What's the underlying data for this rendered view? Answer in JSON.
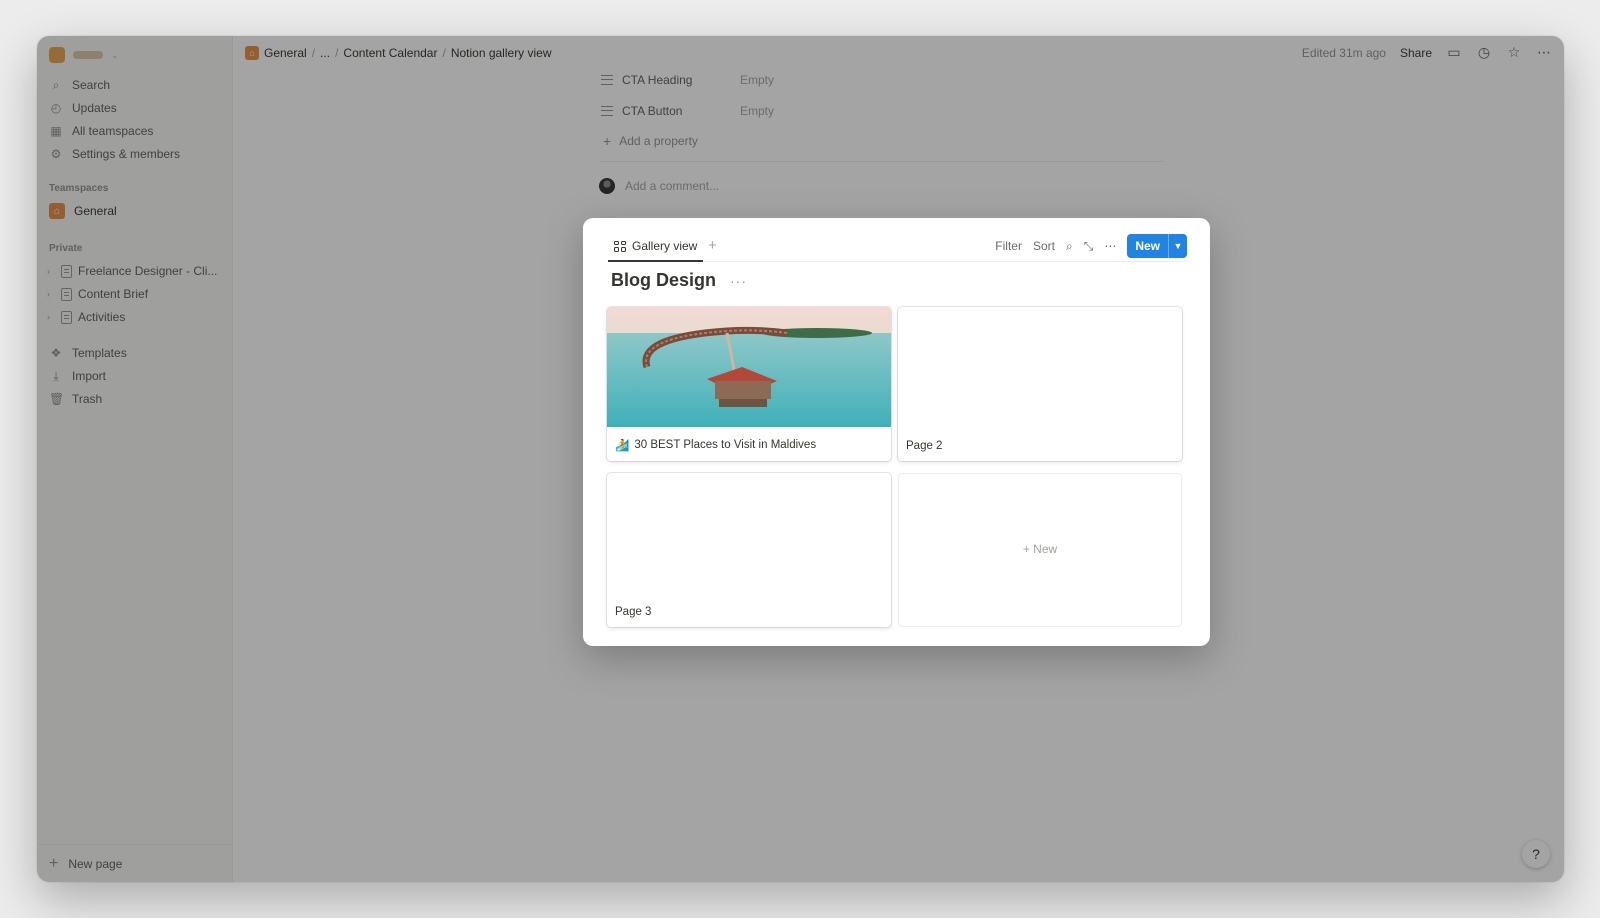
{
  "sidebar": {
    "nav": [
      {
        "label": "Search",
        "icon": "search-icon"
      },
      {
        "label": "Updates",
        "icon": "clock-icon"
      },
      {
        "label": "All teamspaces",
        "icon": "teamspaces-icon"
      },
      {
        "label": "Settings & members",
        "icon": "gear-icon"
      }
    ],
    "teamspaces_label": "Teamspaces",
    "teamspace": {
      "label": "General",
      "icon": "home-icon"
    },
    "private_label": "Private",
    "pages": [
      {
        "label": "Freelance Designer - Cli..."
      },
      {
        "label": "Content Brief"
      },
      {
        "label": "Activities"
      }
    ],
    "tools": [
      {
        "label": "Templates",
        "icon": "templates-icon"
      },
      {
        "label": "Import",
        "icon": "import-icon"
      },
      {
        "label": "Trash",
        "icon": "trash-icon"
      }
    ],
    "new_page": "New page"
  },
  "topbar": {
    "breadcrumb": [
      "General",
      "...",
      "Content Calendar",
      "Notion gallery view"
    ],
    "edited": "Edited 31m ago",
    "share": "Share"
  },
  "page": {
    "properties": [
      {
        "name": "CTA Heading",
        "value": "Empty"
      },
      {
        "name": "CTA Button",
        "value": "Empty"
      }
    ],
    "add_property": "Add a property",
    "comment_placeholder": "Add a comment...",
    "help": "?"
  },
  "modal": {
    "tab_label": "Gallery view",
    "tools": {
      "filter": "Filter",
      "sort": "Sort",
      "new": "New"
    },
    "title": "Blog Design",
    "cards": [
      {
        "title": "30 BEST Places to Visit in Maldives",
        "emoji": "🏄",
        "has_cover": true
      },
      {
        "title": "Page 2",
        "has_cover": false
      },
      {
        "title": "Page 3",
        "has_cover": false
      }
    ],
    "new_card_label": "New"
  },
  "colors": {
    "accent": "#2383e2",
    "home_icon": "#e48f45"
  }
}
